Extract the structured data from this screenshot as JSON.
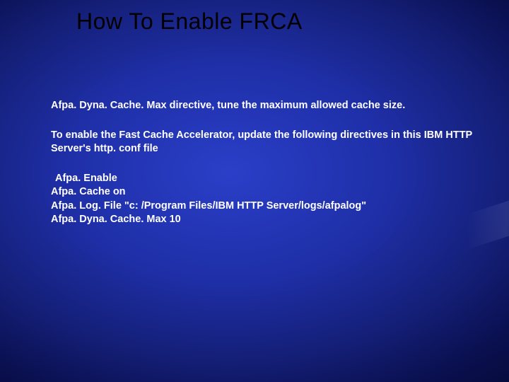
{
  "title": "How To Enable FRCA",
  "para1": "Afpa. Dyna. Cache. Max directive, tune the maximum allowed cache size.",
  "para2": "To enable the Fast Cache Accelerator, update the following directives in this IBM HTTP Server's http. conf file",
  "code": {
    "l1": "Afpa. Enable",
    "l2": "Afpa. Cache on",
    "l3": "Afpa. Log. File \"c: /Program Files/IBM HTTP Server/logs/afpalog\"",
    "l4": "Afpa. Dyna. Cache. Max 10"
  }
}
